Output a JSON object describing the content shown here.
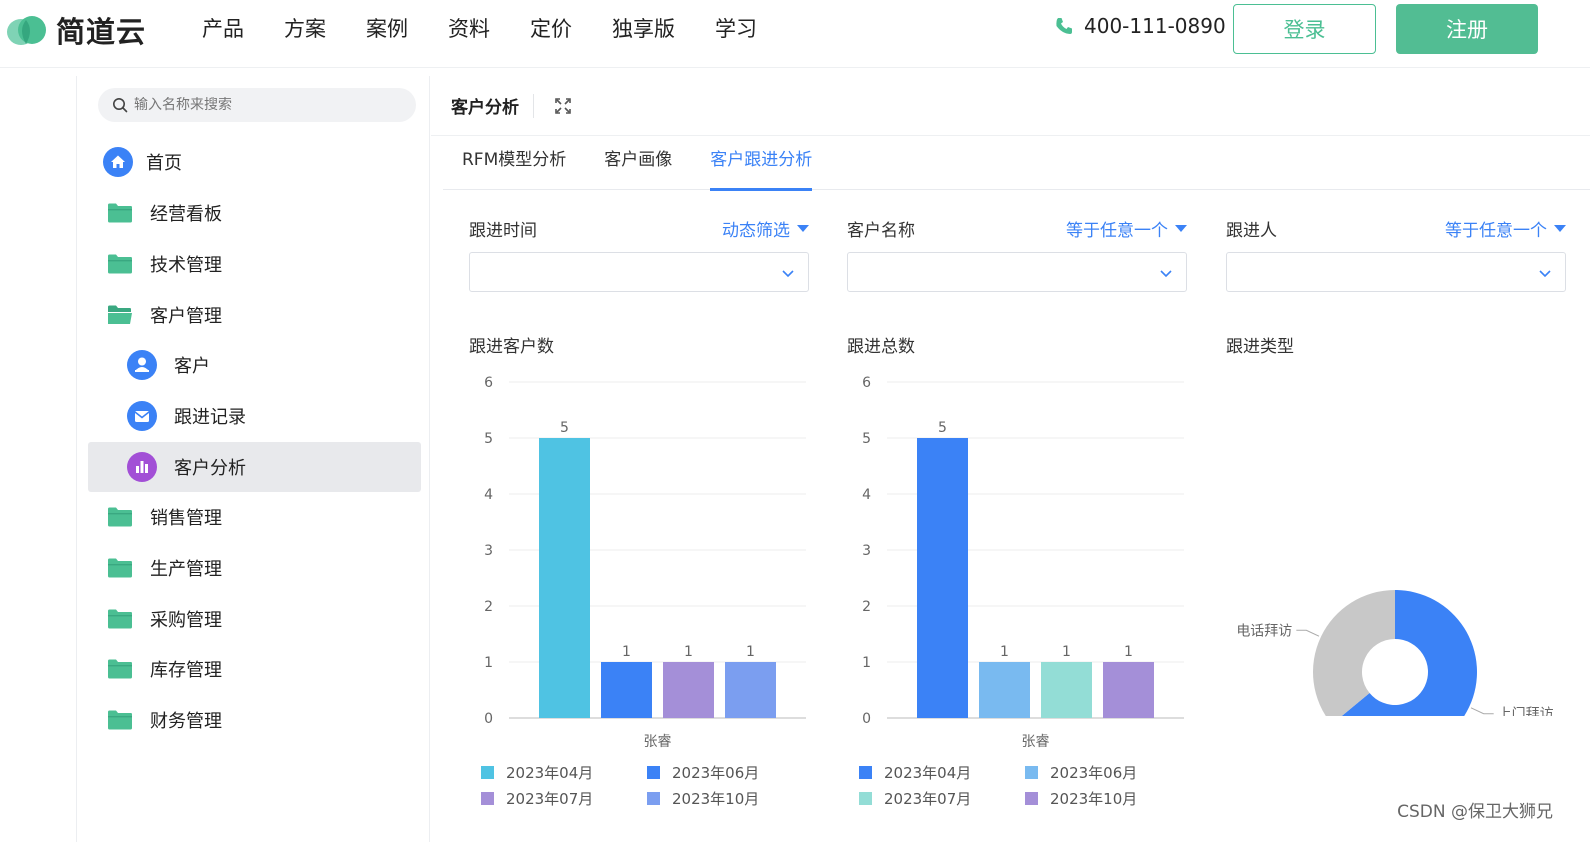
{
  "brand": {
    "name": "简道云"
  },
  "nav": [
    "产品",
    "方案",
    "案例",
    "资料",
    "定价",
    "独享版",
    "学习"
  ],
  "contact": {
    "phone": "400-111-0890"
  },
  "auth": {
    "login": "登录",
    "register": "注册"
  },
  "sidebar": {
    "search_placeholder": "输入名称来搜索",
    "items": [
      {
        "label": "首页",
        "icon": "home-icon"
      },
      {
        "label": "经营看板",
        "icon": "folder-icon"
      },
      {
        "label": "技术管理",
        "icon": "folder-icon"
      },
      {
        "label": "客户管理",
        "icon": "folder-open-icon"
      },
      {
        "label": "客户",
        "icon": "person-icon"
      },
      {
        "label": "跟进记录",
        "icon": "mail-icon"
      },
      {
        "label": "客户分析",
        "icon": "bar-chart-icon",
        "active": true
      },
      {
        "label": "销售管理",
        "icon": "folder-icon"
      },
      {
        "label": "生产管理",
        "icon": "folder-icon"
      },
      {
        "label": "采购管理",
        "icon": "folder-icon"
      },
      {
        "label": "库存管理",
        "icon": "folder-icon"
      },
      {
        "label": "财务管理",
        "icon": "folder-icon"
      }
    ]
  },
  "main": {
    "title": "客户分析",
    "tabs": [
      {
        "label": "RFM模型分析"
      },
      {
        "label": "客户画像"
      },
      {
        "label": "客户跟进分析",
        "active": true
      }
    ],
    "filters": [
      {
        "label": "跟进时间",
        "mode": "动态筛选"
      },
      {
        "label": "客户名称",
        "mode": "等于任意一个"
      },
      {
        "label": "跟进人",
        "mode": "等于任意一个"
      }
    ]
  },
  "colors": {
    "accent": "#3b82f6",
    "brand_green": "#52bd93"
  },
  "chart_data": [
    {
      "type": "bar",
      "title": "跟进客户数",
      "categories": [
        "张睿"
      ],
      "ylim": [
        0,
        6
      ],
      "yticks": [
        0,
        1,
        2,
        3,
        4,
        5,
        6
      ],
      "series": [
        {
          "name": "2023年04月",
          "values": [
            5
          ],
          "color": "#4fc3e3"
        },
        {
          "name": "2023年06月",
          "values": [
            1
          ],
          "color": "#3b82f6"
        },
        {
          "name": "2023年07月",
          "values": [
            1
          ],
          "color": "#a48fd8"
        },
        {
          "name": "2023年10月",
          "values": [
            1
          ],
          "color": "#7b9ef0"
        }
      ],
      "grid": true,
      "legend": "bottom"
    },
    {
      "type": "bar",
      "title": "跟进总数",
      "categories": [
        "张睿"
      ],
      "ylim": [
        0,
        6
      ],
      "yticks": [
        0,
        1,
        2,
        3,
        4,
        5,
        6
      ],
      "series": [
        {
          "name": "2023年04月",
          "values": [
            5
          ],
          "color": "#3b82f6"
        },
        {
          "name": "2023年06月",
          "values": [
            1
          ],
          "color": "#79baf0"
        },
        {
          "name": "2023年07月",
          "values": [
            1
          ],
          "color": "#93ddd6"
        },
        {
          "name": "2023年10月",
          "values": [
            1
          ],
          "color": "#a48fd8"
        }
      ],
      "grid": true,
      "legend": "bottom"
    },
    {
      "type": "pie",
      "title": "跟进类型",
      "slices": [
        {
          "name": "上门拜访",
          "value": 64,
          "color": "#3b82f6"
        },
        {
          "name": "电话拜访",
          "value": 36,
          "color": "#c8c8c8"
        }
      ]
    }
  ],
  "watermark": "CSDN @保卫大狮兄"
}
